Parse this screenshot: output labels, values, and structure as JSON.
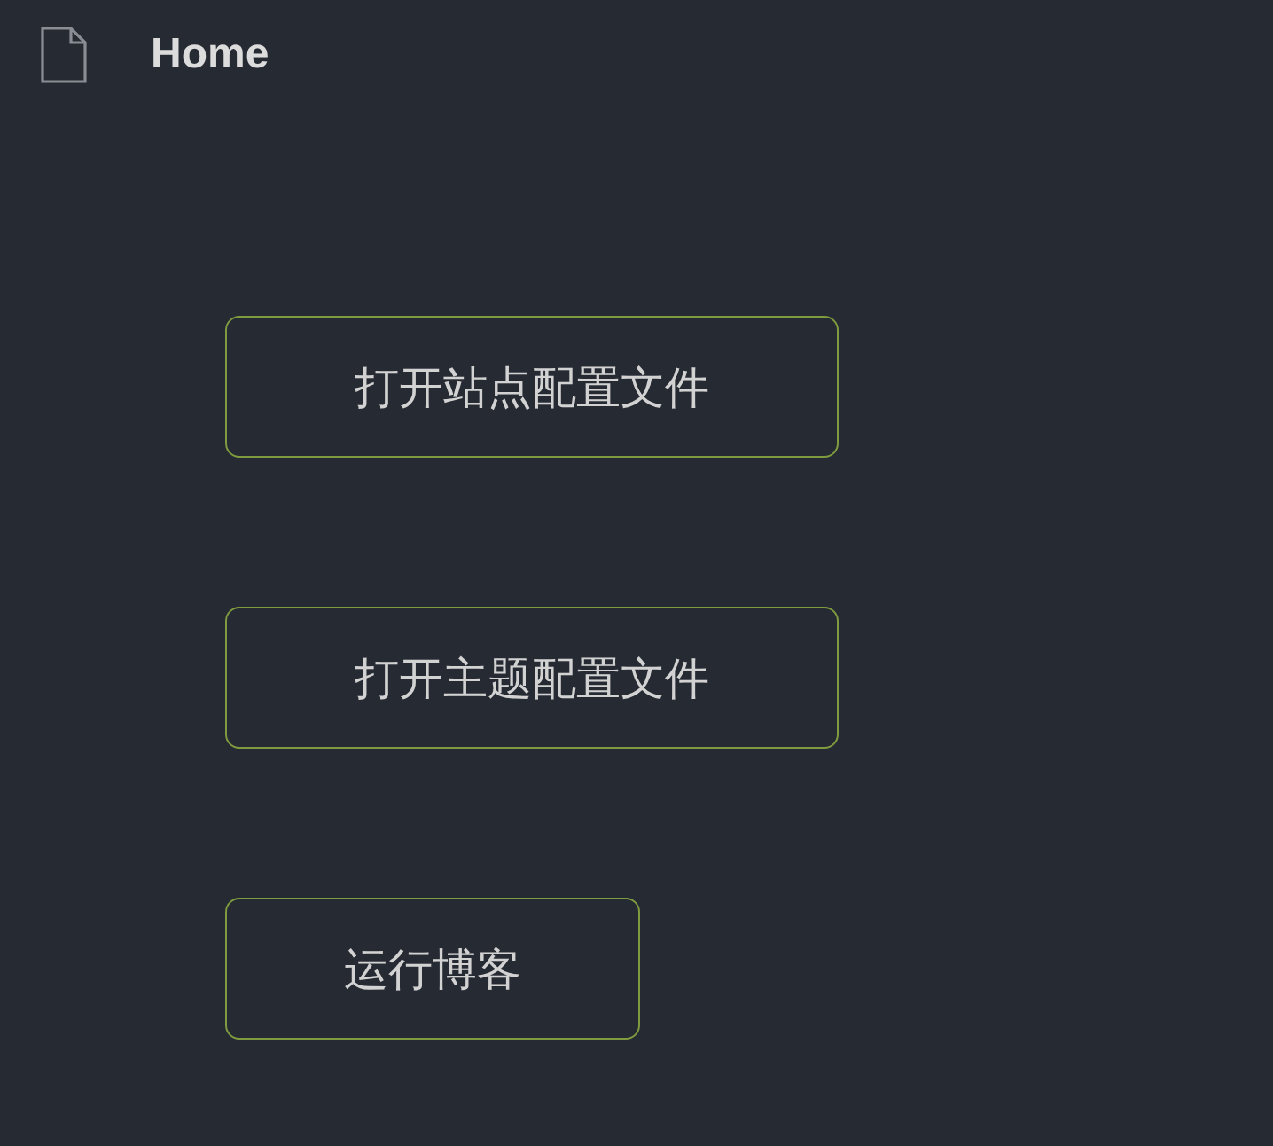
{
  "header": {
    "title": "Home"
  },
  "buttons": [
    {
      "label": "打开站点配置文件"
    },
    {
      "label": "打开主题配置文件"
    },
    {
      "label": "运行博客"
    }
  ]
}
